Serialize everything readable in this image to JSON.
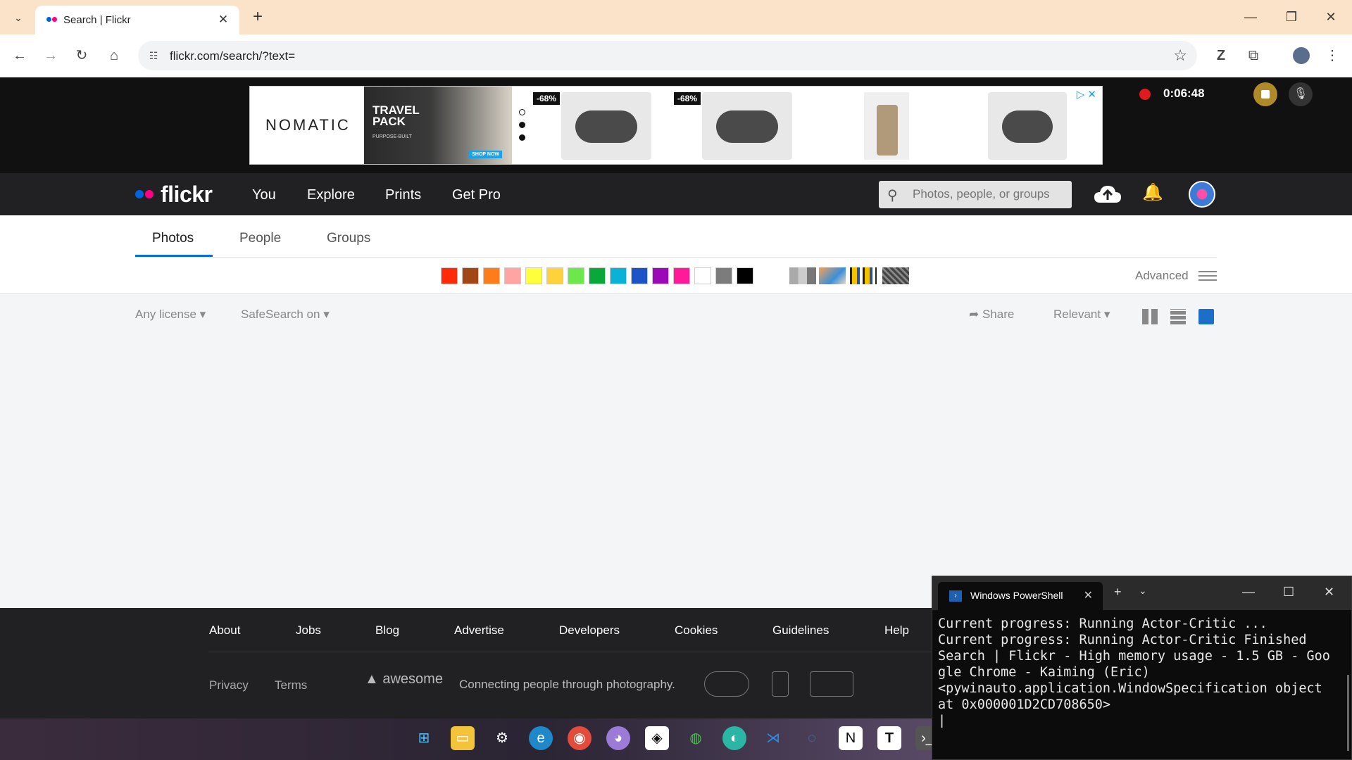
{
  "browser": {
    "tab_title": "Search | Flickr",
    "url": "flickr.com/search/?text="
  },
  "ad": {
    "brand": "NOMATIC",
    "promo_title": "TRAVEL PACK",
    "promo_sub": "PURPOSE-BUILT",
    "promo_cta": "SHOP NOW",
    "discount_1": "-68%",
    "discount_2": "-68%"
  },
  "recorder": {
    "time": "0:06:48"
  },
  "flickr_nav": {
    "logo": "flickr",
    "menu": [
      "You",
      "Explore",
      "Prints",
      "Get Pro"
    ],
    "search_placeholder": "Photos, people, or groups"
  },
  "search_tabs": [
    "Photos",
    "People",
    "Groups"
  ],
  "active_tab": "Photos",
  "color_swatches": [
    "#ff2a0a",
    "#a24615",
    "#ff7c1a",
    "#ffa3a3",
    "#fefe3a",
    "#ffd13a",
    "#6de84a",
    "#0aa83a",
    "#0ab2d6",
    "#1c53c8",
    "#9a0ab6",
    "#ff1a9a",
    "#ffffff",
    "#7c7c7c",
    "#000000"
  ],
  "advanced_label": "Advanced",
  "filters": {
    "license": "Any license",
    "safesearch": "SafeSearch on",
    "share": "Share",
    "sort": "Relevant"
  },
  "footer": {
    "links": [
      "About",
      "Jobs",
      "Blog",
      "Advertise",
      "Developers",
      "Cookies",
      "Guidelines",
      "Help"
    ],
    "small_links": [
      "Privacy",
      "Terms"
    ],
    "awesome": "awesome",
    "tagline": "Connecting people through photography."
  },
  "powershell": {
    "title": "Windows PowerShell",
    "output": "Current progress: Running Actor-Critic ...\nCurrent progress: Running Actor-Critic Finished\nSearch | Flickr - High memory usage - 1.5 GB - Google Chrome - Kaiming (Eric)\n<pywinauto.application.WindowSpecification object at 0x000001D2CD708650>\n|"
  }
}
